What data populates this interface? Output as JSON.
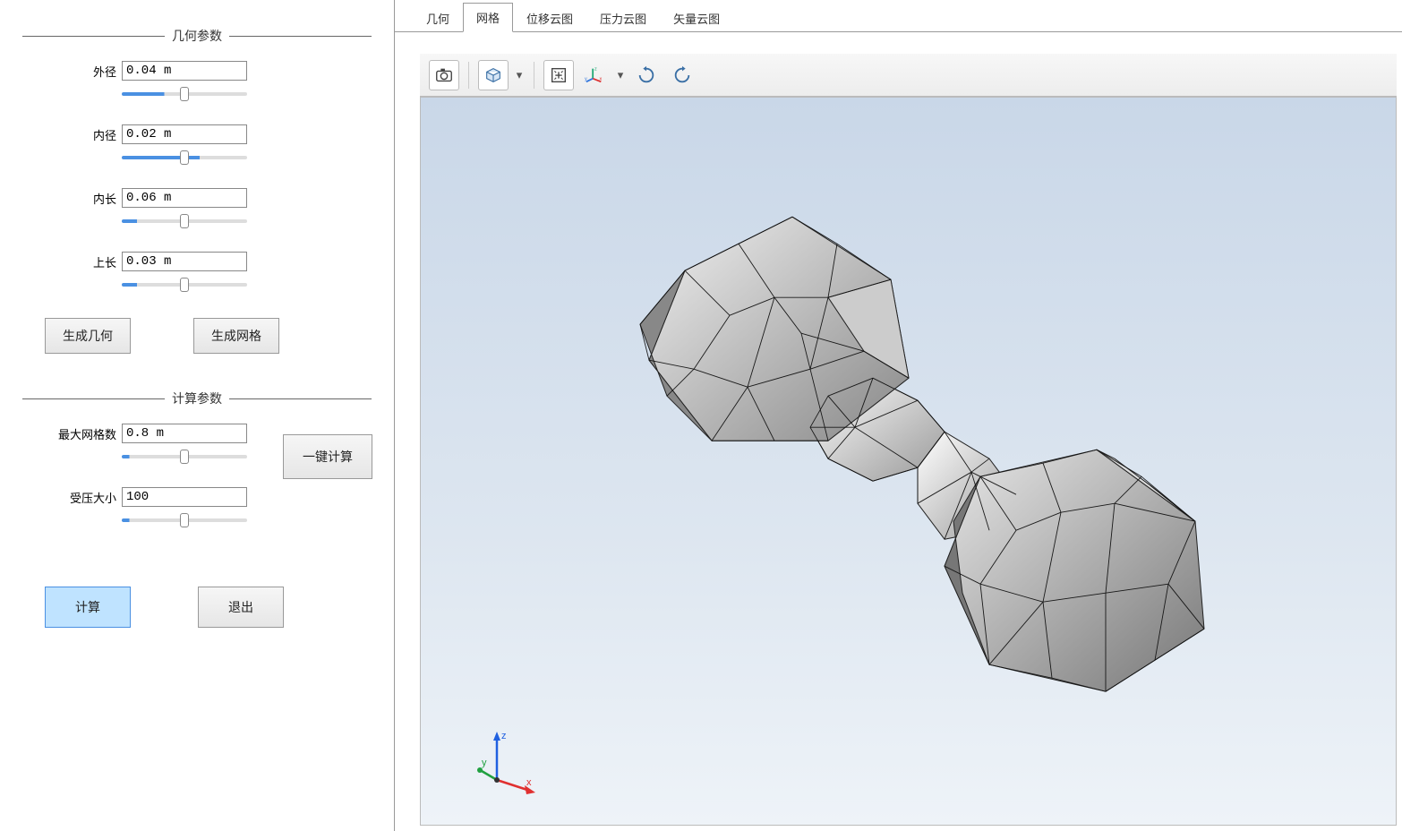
{
  "groups": {
    "geometry_title": "几何参数",
    "calc_title": "计算参数"
  },
  "params": {
    "outer_radius": {
      "label": "外径",
      "value": "0.04 m",
      "fill": "34%"
    },
    "inner_radius": {
      "label": "内径",
      "value": "0.02 m",
      "fill": "62%"
    },
    "inner_length": {
      "label": "内长",
      "value": "0.06 m",
      "fill": "12%"
    },
    "upper_length": {
      "label": "上长",
      "value": "0.03 m",
      "fill": "12%"
    },
    "max_mesh": {
      "label": "最大网格数",
      "value": "0.8 m",
      "fill": "6%"
    },
    "pressure": {
      "label": "受压大小",
      "value": "100",
      "fill": "6%"
    }
  },
  "buttons": {
    "gen_geom": "生成几何",
    "gen_mesh": "生成网格",
    "one_click": "一键计算",
    "calc": "计算",
    "exit": "退出"
  },
  "tabs": [
    {
      "key": "geom",
      "label": "几何"
    },
    {
      "key": "mesh",
      "label": "网格"
    },
    {
      "key": "disp",
      "label": "位移云图"
    },
    {
      "key": "pres",
      "label": "压力云图"
    },
    {
      "key": "vect",
      "label": "矢量云图"
    }
  ],
  "active_tab": "mesh",
  "toolbar_icons": {
    "camera": "camera-icon",
    "cube": "cube-view-icon",
    "fit": "fit-view-icon",
    "axes": "axes-icon",
    "rotate_cw": "rotate-cw-icon",
    "rotate_ccw": "rotate-ccw-icon"
  },
  "axes_labels": {
    "x": "x",
    "y": "y",
    "z": "z"
  }
}
